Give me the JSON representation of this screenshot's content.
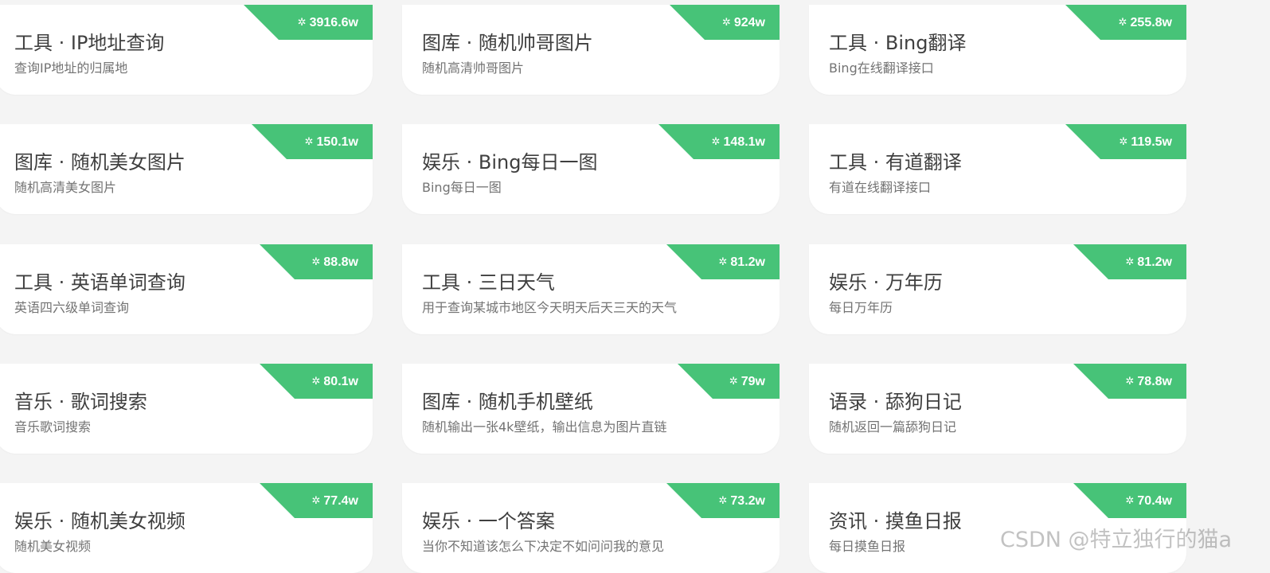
{
  "cards": [
    {
      "title": "工具 · IP地址查询",
      "desc": "查询IP地址的归属地",
      "count": "3916.6w"
    },
    {
      "title": "图库 · 随机帅哥图片",
      "desc": "随机高清帅哥图片",
      "count": "924w"
    },
    {
      "title": "工具 · Bing翻译",
      "desc": "Bing在线翻译接口",
      "count": "255.8w"
    },
    {
      "title": "图库 · 随机美女图片",
      "desc": "随机高清美女图片",
      "count": "150.1w"
    },
    {
      "title": "娱乐 · Bing每日一图",
      "desc": "Bing每日一图",
      "count": "148.1w"
    },
    {
      "title": "工具 · 有道翻译",
      "desc": "有道在线翻译接口",
      "count": "119.5w"
    },
    {
      "title": "工具 · 英语单词查询",
      "desc": "英语四六级单词查询",
      "count": "88.8w"
    },
    {
      "title": "工具 · 三日天气",
      "desc": "用于查询某城市地区今天明天后天三天的天气",
      "count": "81.2w"
    },
    {
      "title": "娱乐 · 万年历",
      "desc": "每日万年历",
      "count": "81.2w"
    },
    {
      "title": "音乐 · 歌词搜索",
      "desc": "音乐歌词搜索",
      "count": "80.1w"
    },
    {
      "title": "图库 · 随机手机壁纸",
      "desc": "随机输出一张4k壁纸，输出信息为图片直链",
      "count": "79w"
    },
    {
      "title": "语录 · 舔狗日记",
      "desc": "随机返回一篇舔狗日记",
      "count": "78.8w"
    },
    {
      "title": "娱乐 · 随机美女视频",
      "desc": "随机美女视频",
      "count": "77.4w"
    },
    {
      "title": "娱乐 · 一个答案",
      "desc": "当你不知道该怎么下决定不如问问我的意见",
      "count": "73.2w"
    },
    {
      "title": "资讯 · 摸鱼日报",
      "desc": "每日摸鱼日报",
      "count": "70.4w"
    }
  ],
  "ribbon_icon": "gear-icon",
  "ribbon_icon_glyph": "✲",
  "colors": {
    "ribbon": "#47c378",
    "card": "#ffffff",
    "background": "#f4f4f4",
    "title": "#3f3f3f",
    "desc": "#737373"
  },
  "watermark": "CSDN @特立独行的猫a"
}
